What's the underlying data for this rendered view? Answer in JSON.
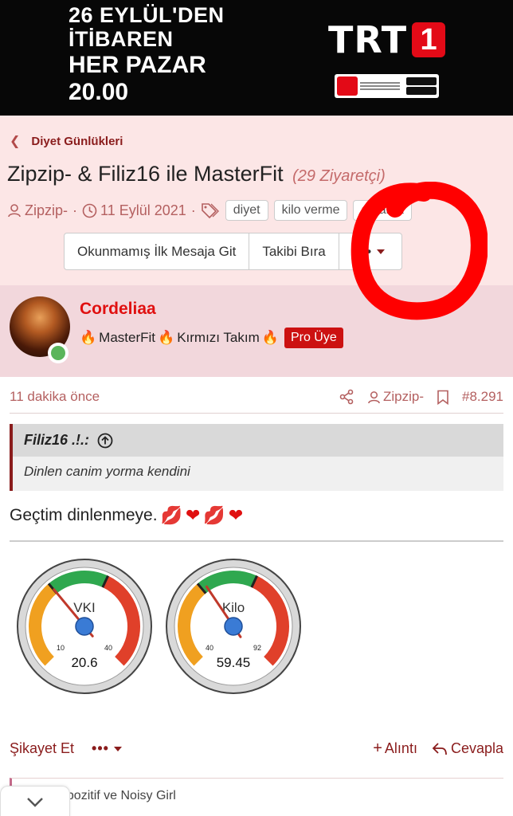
{
  "ad": {
    "line1": "26 EYLÜL'DEN",
    "line2": "İTİBAREN",
    "line3": "HER PAZAR",
    "line4": "20.00",
    "brand": "TRT",
    "brand_number": "1"
  },
  "breadcrumb": {
    "label": "Diyet Günlükleri"
  },
  "thread": {
    "title": "Zipzip- & Filiz16 ile MasterFit",
    "visitors": "(29 Ziyaretçi)",
    "author": "Zipzip-",
    "date": "11 Eylül 2021",
    "tags": [
      "diyet",
      "kilo verme",
      "amama"
    ],
    "buttons": {
      "first_unread": "Okunmamış İlk Mesaja Git",
      "unfollow": "Takibi Bıra",
      "more": "•••"
    }
  },
  "post": {
    "username": "Cordeliaa",
    "user_title": "MasterFit",
    "user_title_team": "Kırmızı Takım",
    "badge": "Pro Üye",
    "time": "11 dakika önce",
    "mention": "Zipzip-",
    "post_number": "#8.291",
    "quote_author": "Filiz16 .!.:",
    "quote_text": "Dinlen canim yorma kendini",
    "text": "Geçtim dinlenmeye.",
    "gauges": [
      {
        "label": "VKI",
        "value": "20.6",
        "min": "10",
        "max": "40",
        "needle": 20.6,
        "range": [
          10,
          40
        ]
      },
      {
        "label": "Kilo",
        "value": "59.45",
        "min": "40",
        "max": "92",
        "needle": 59.45,
        "range": [
          40,
          92
        ]
      }
    ],
    "actions": {
      "report": "Şikayet Et",
      "more": "•••",
      "quote": "Alıntı",
      "reply": "Cevapla"
    },
    "likes_text": "hpozitif ve Noisy Girl"
  },
  "colors": {
    "accent": "#8a1c1c",
    "header_bg": "#fce6e6",
    "user_strip_bg": "#f2d7dc",
    "username": "#e01010",
    "annotation": "#ff0000"
  }
}
